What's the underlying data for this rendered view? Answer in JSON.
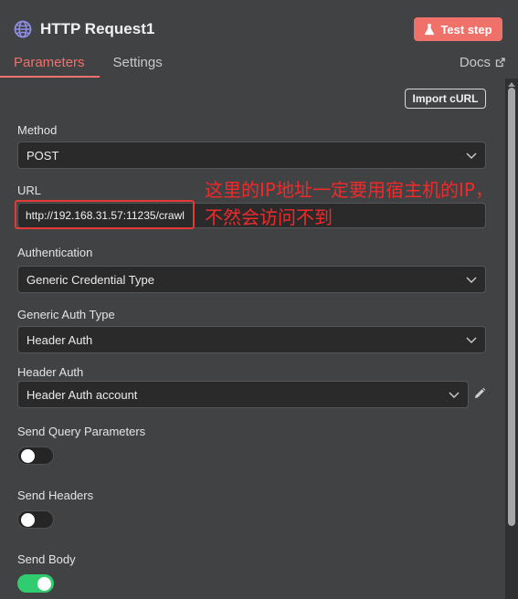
{
  "header": {
    "title": "HTTP Request1",
    "test_button": "Test step",
    "tabs": [
      "Parameters",
      "Settings"
    ],
    "docs_label": "Docs"
  },
  "import_button": "Import cURL",
  "method": {
    "label": "Method",
    "value": "POST"
  },
  "url": {
    "label": "URL",
    "value": "http://192.168.31.57:11235/crawl"
  },
  "annotation": {
    "line1": "这里的IP地址一定要用宿主机的IP，",
    "line2": "不然会访问不到",
    "color": "#f02a2a"
  },
  "authentication": {
    "label": "Authentication",
    "value": "Generic Credential Type"
  },
  "generic_auth_type": {
    "label": "Generic Auth Type",
    "value": "Header Auth"
  },
  "header_auth": {
    "label": "Header Auth",
    "value": "Header Auth account"
  },
  "send_query_parameters": {
    "label": "Send Query Parameters",
    "enabled": false
  },
  "send_headers": {
    "label": "Send Headers",
    "enabled": false
  },
  "send_body": {
    "label": "Send Body",
    "enabled": true
  },
  "colors": {
    "accent": "#f0706a",
    "toggle_on": "#2fcd6f",
    "panel": "#414244"
  },
  "icons": [
    "globe-icon",
    "flask-icon",
    "external-link-icon",
    "chevron-down-icon",
    "pencil-icon"
  ]
}
